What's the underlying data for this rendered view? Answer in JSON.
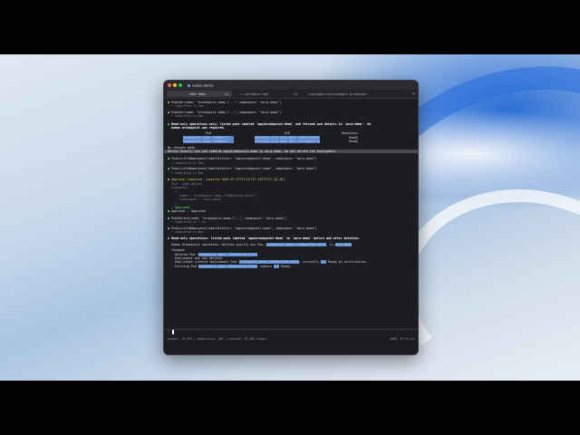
{
  "window": {
    "title": "make demo"
  },
  "tabs": [
    {
      "label": "make demo",
      "shortcut": "⌘1"
    },
    {
      "label": "~/.configure.toml",
      "shortcut": "⌘2"
    },
    {
      "label": "/workspace/aura/example-breakpoint",
      "shortcut": "⌘3"
    }
  ],
  "log": {
    "l1": "PodsGet(name: \"breakpoint-demo-7...\", namespace: \"aura-demo\")",
    "l1s": "completed in 7ms",
    "l2": "PodsGet(name: \"breakpoint-demo-7...\", namespace: \"aura-demo\")",
    "l2s": "completed in 6ms",
    "l3": "Read-only operations only: listed pods labeled `app=breakpoint-demo` and fetched pod details in `aura-demo`. No",
    "l3b": "human breakpoint was required.",
    "table_headers": [
      "Pod",
      "UID",
      "Readiness"
    ],
    "table_rows": [
      [
        "breakpoint-demo-7f6d8ec57...",
        "6dae4c0b-1f2a-4e3b-9b7c-1a2b3c4d5e6f",
        "Ready"
      ],
      [
        "breakpoint-demo-7f6d8ec57...",
        "8fb2e1d4-3c5a-4b6e-8d7f-2b3c4d5e6f70",
        "Ready"
      ]
    ],
    "no_changes": "No changes made.",
    "instruction": "Delete exactly one pod labeled app=breakpoint-demo in aura-demo. Do not delete the Deployment.",
    "l4": "PodsListInNamespace(labelSelector: \"app=breakpoint-demo\", namespace: \"aura-demo\")",
    "l4s": "completed in 6ms",
    "l5": "PodsListInNamespace(labelSelector: \"app=breakpoint-demo\", namespace: \"aura-demo\")",
    "l5s": "completed in 6ms",
    "approval": "Approval required  (expires 2026-07-27T11:14:37.139727Z) [8.48]",
    "tool": "Tool  pods_delete",
    "args_label": "Arguments",
    "args_open": "{",
    "arg_name": "\"name\": \"breakpoint-demo-7f6d8ec57dd-d2vk4\",",
    "arg_ns": "\"namespace\": \"aura-demo\"",
    "args_close": "}",
    "approved": "✓ Approved",
    "approval_done": "Approval ✓ Approved",
    "l6": "PodsDelete(name: \"breakpoint-demo-7...\", namespace: \"aura-demo\")",
    "l6s": "completed in 7.4s",
    "l7": "PodsListInNamespace(labelSelector: \"app=breakpoint-demo\", namespace: \"aura-demo\")",
    "l7s": "completed in 6ms",
    "l8": "Read-only operations: listed pods labeled `app=breakpoint-demo` in `aura-demo` before and after deletion.",
    "l9a": "Human breakpoint operation: deleted exactly one Pod,",
    "l9b": "breakpoint-demo-7f6d8ec57dd-d2vk4",
    "l9c": ", in",
    "l9d": "aura-demo",
    "changed": "Changed:",
    "c1a": "- Deleted Pod:",
    "c1b": "breakpoint-demo-7f6d8ec57dd-d2vk4",
    "c2": "- Deployment was not deleted.",
    "c3a": "- ReplicaSet created replacement Pod:",
    "c3b": "breakpoint-demo-7f6d8ec57dd-xq8lm",
    "c3c": ", currently",
    "c3d": "1/1",
    "c3e": " Ready at verification.",
    "c4a": "- Existing Pod",
    "c4b": "breakpoint-demo-7f6d8ec57dd-9ktwn",
    "c4c": " remains",
    "c4d": "1/1",
    "c4e": " Ready."
  },
  "status": {
    "left": "prompt: 18,965 | completion: 385 | context: 19,488 tokens",
    "right": "468K, 5% Re:ex"
  },
  "colors": {
    "close": "#ff5f57",
    "min": "#febc2e",
    "max": "#28c840",
    "highlight": "#5a86c8"
  },
  "icons": {
    "tab_icon": "terminal-icon",
    "pointer": "mouse-pointer-icon"
  }
}
